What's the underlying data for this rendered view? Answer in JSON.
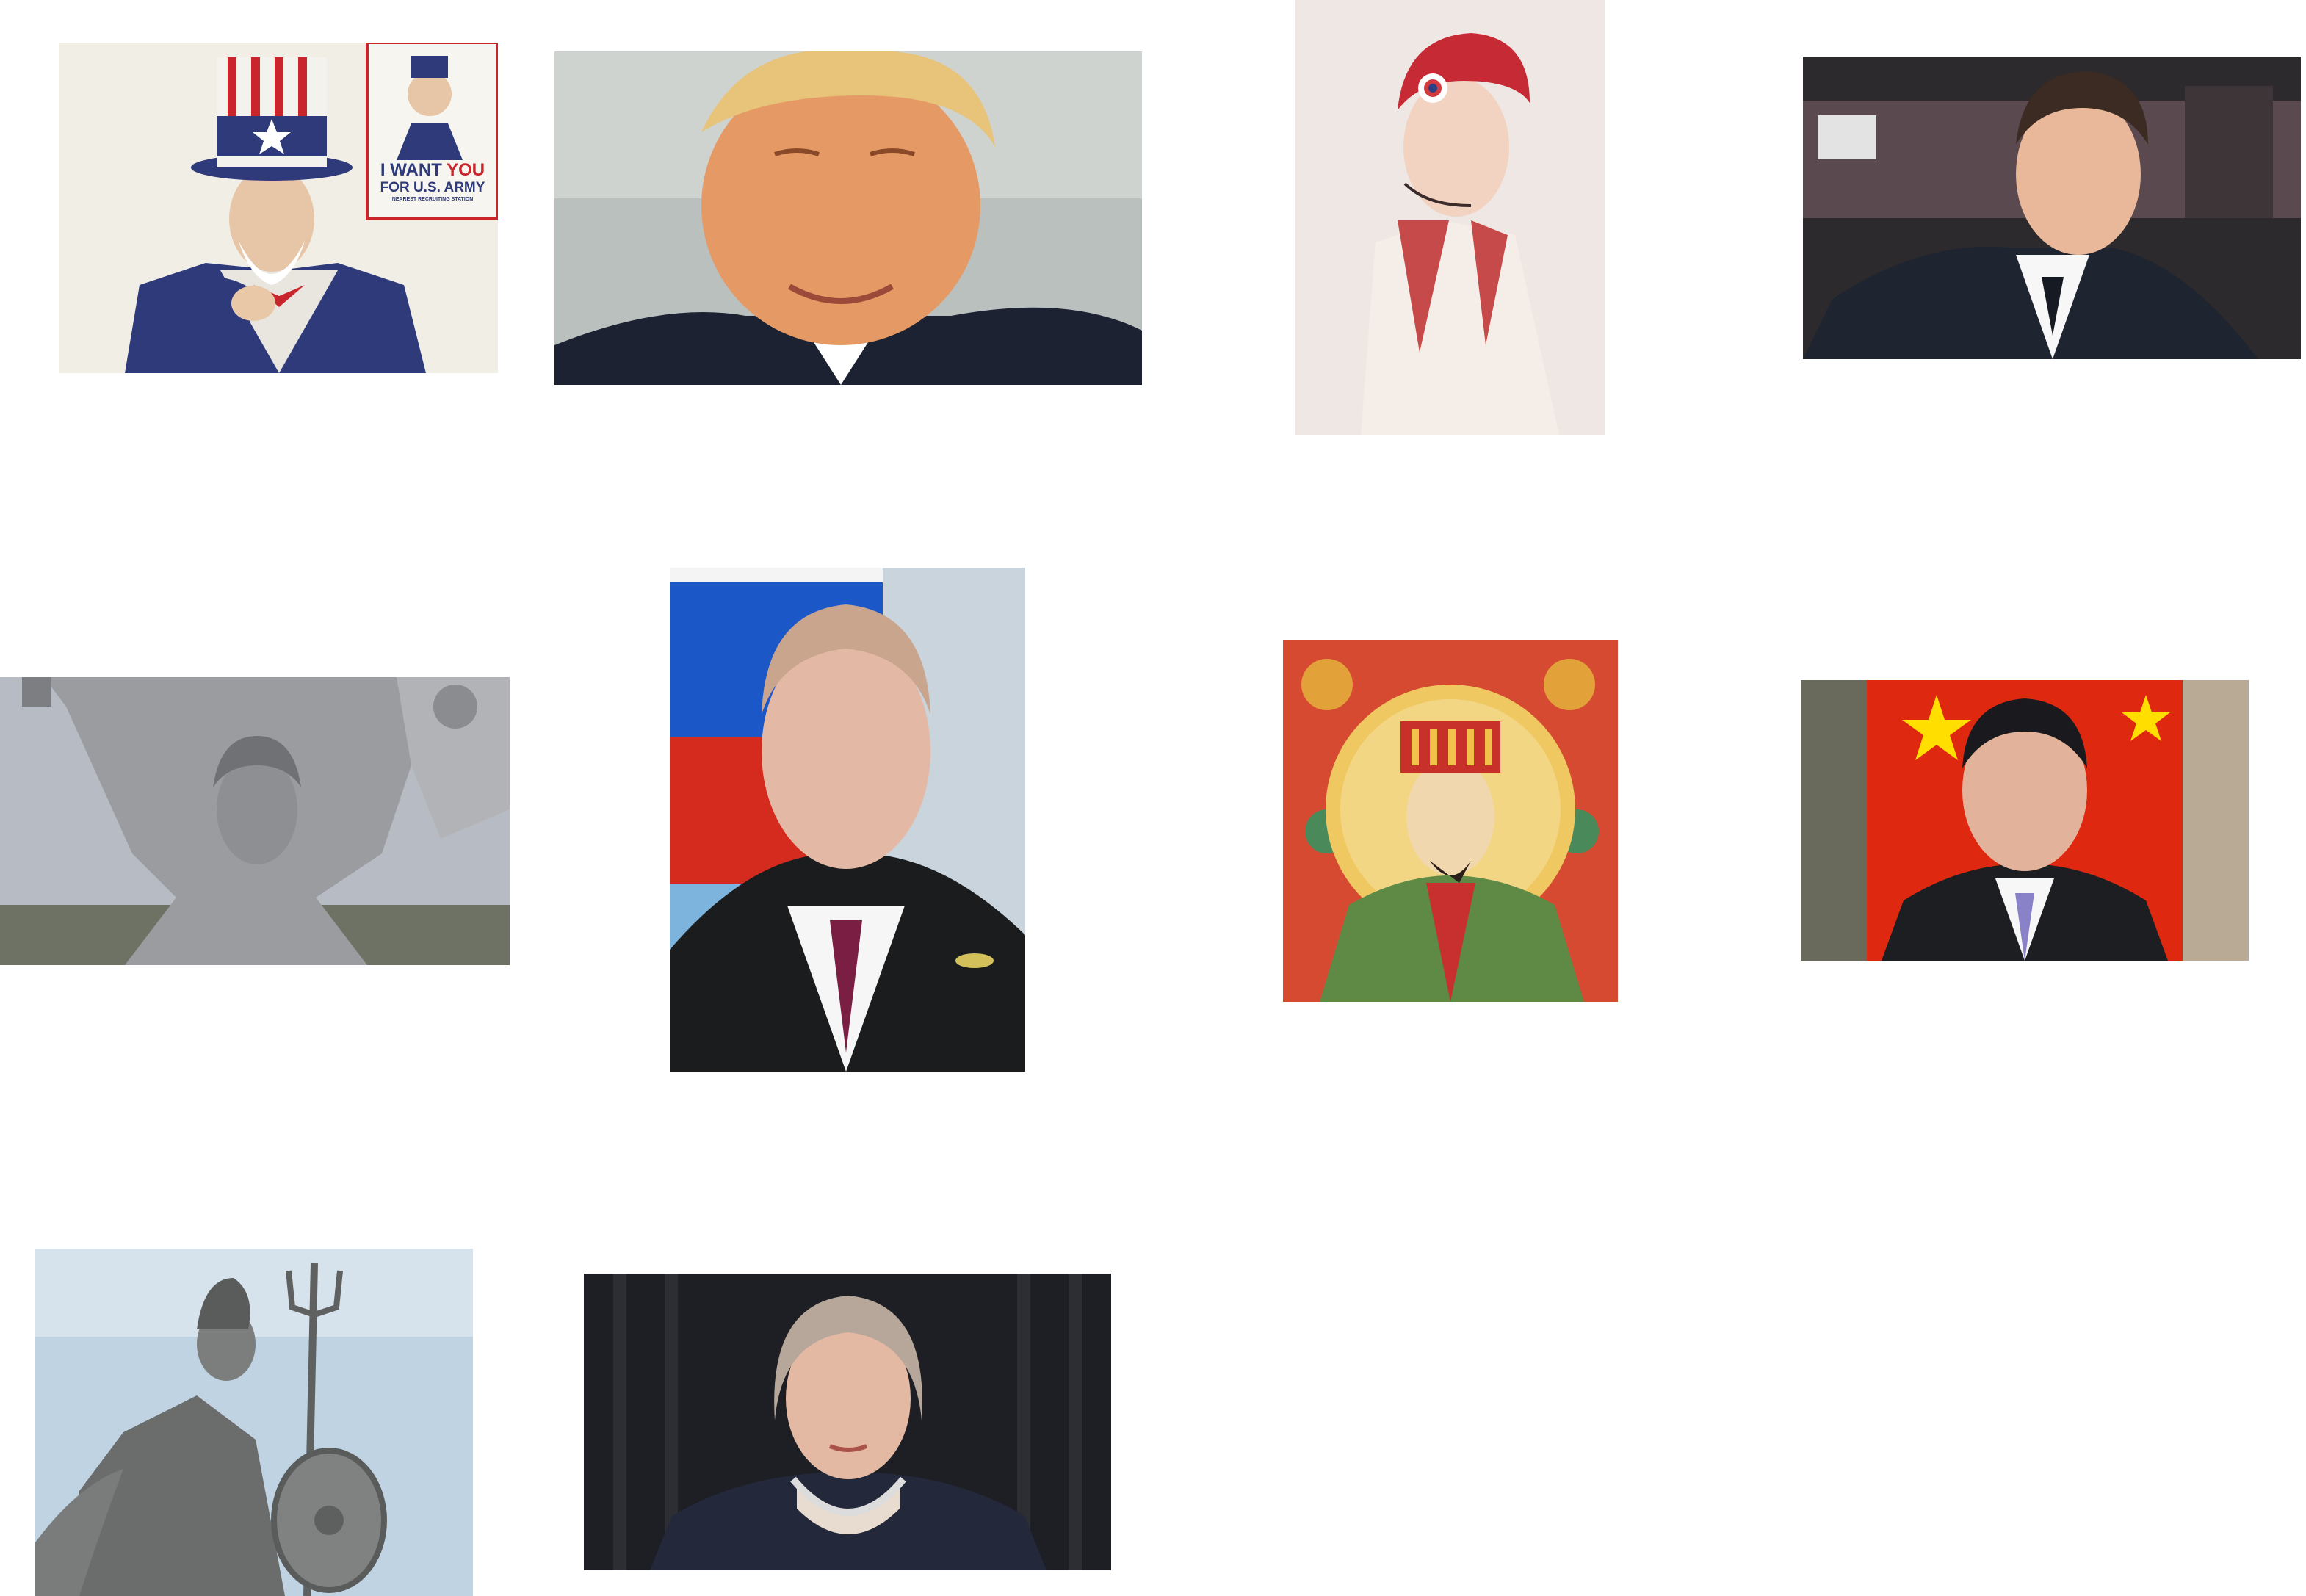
{
  "poster": {
    "line1_a": "I WANT ",
    "line1_b": "YOU",
    "line2": "FOR U.S. ARMY",
    "line3": "NEAREST RECRUITING STATION"
  },
  "colors": {
    "background": "#ffffff",
    "poster_red": "#c8252c",
    "poster_navy": "#2f3a7a",
    "flag_red": "#de2910",
    "flag_yellow": "#ffde00",
    "ru_blue": "#1c57c7",
    "ru_red": "#d52b1e"
  }
}
